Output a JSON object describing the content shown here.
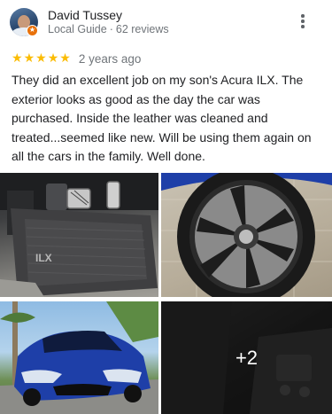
{
  "reviewer": {
    "name": "David Tussey",
    "badge": "Local Guide",
    "separator": "·",
    "reviews_count": "62 reviews"
  },
  "review": {
    "rating": 5,
    "stars": [
      "★",
      "★",
      "★",
      "★",
      "★"
    ],
    "age": "2 years ago",
    "text": "They did an excellent job on my son's Acura ILX. The exterior looks as good as the day the car was purchased. Inside the leather was cleaned and treated...seemed like new. Will be using them again on all the cars in the family. Well done."
  },
  "photos": {
    "more_count": "+2",
    "floor_mat_label": "ILX"
  },
  "colors": {
    "star": "#fbbc04",
    "secondary_text": "#70757a",
    "guide_badge": "#e8710a",
    "car_blue": "#1e3fa8"
  },
  "icons": {
    "menu": "more-vert-icon",
    "badge": "local-guide-icon",
    "star": "star-icon"
  }
}
